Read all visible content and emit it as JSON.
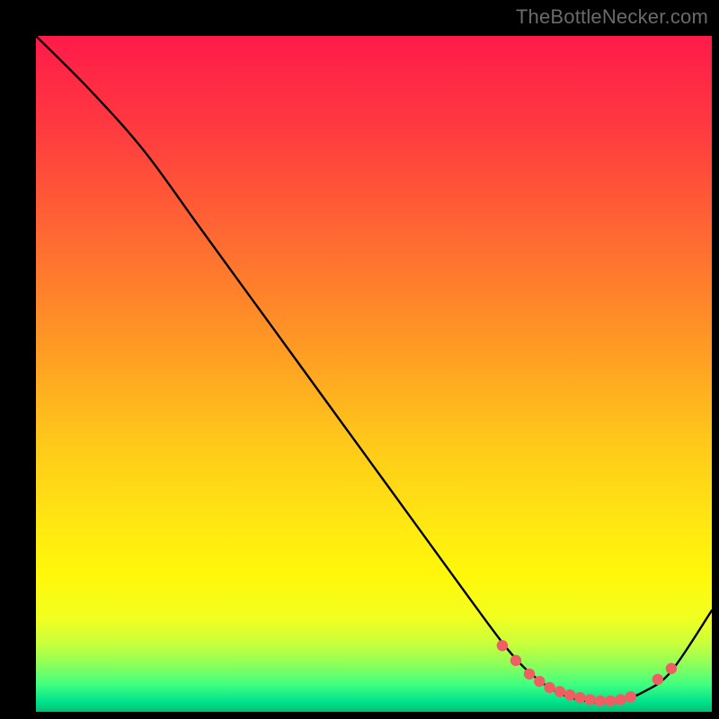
{
  "watermark": "TheBottleNecker.com",
  "chart_data": {
    "type": "line",
    "title": "",
    "xlabel": "",
    "ylabel": "",
    "xlim": [
      0,
      100
    ],
    "ylim": [
      0,
      100
    ],
    "series": [
      {
        "name": "curve",
        "x": [
          0,
          8,
          16,
          24,
          32,
          40,
          48,
          56,
          64,
          70,
          74,
          78,
          82,
          86,
          90,
          94,
          100
        ],
        "y": [
          100,
          92,
          83,
          72,
          61,
          50,
          39,
          28,
          17,
          9,
          5,
          2.5,
          1.5,
          1.5,
          3,
          6,
          15
        ]
      }
    ],
    "markers": {
      "name": "highlight-points",
      "x": [
        69,
        71,
        73,
        74.5,
        76,
        77.5,
        79,
        80.5,
        82,
        83.5,
        85,
        86.5,
        88,
        92,
        94
      ],
      "y": [
        9.8,
        7.6,
        5.6,
        4.5,
        3.6,
        3.0,
        2.5,
        2.1,
        1.8,
        1.6,
        1.6,
        1.8,
        2.2,
        4.8,
        6.4
      ]
    },
    "background_gradient_stops": [
      {
        "offset": 0.0,
        "color": "#ff1a4a"
      },
      {
        "offset": 0.14,
        "color": "#ff3b3f"
      },
      {
        "offset": 0.3,
        "color": "#ff6a32"
      },
      {
        "offset": 0.46,
        "color": "#ff9a24"
      },
      {
        "offset": 0.6,
        "color": "#ffc81a"
      },
      {
        "offset": 0.72,
        "color": "#ffe712"
      },
      {
        "offset": 0.8,
        "color": "#fff80a"
      },
      {
        "offset": 0.86,
        "color": "#f2ff20"
      },
      {
        "offset": 0.9,
        "color": "#c8ff3c"
      },
      {
        "offset": 0.93,
        "color": "#8cff5a"
      },
      {
        "offset": 0.96,
        "color": "#40ff80"
      },
      {
        "offset": 0.985,
        "color": "#00e28c"
      },
      {
        "offset": 1.0,
        "color": "#00c076"
      }
    ]
  }
}
